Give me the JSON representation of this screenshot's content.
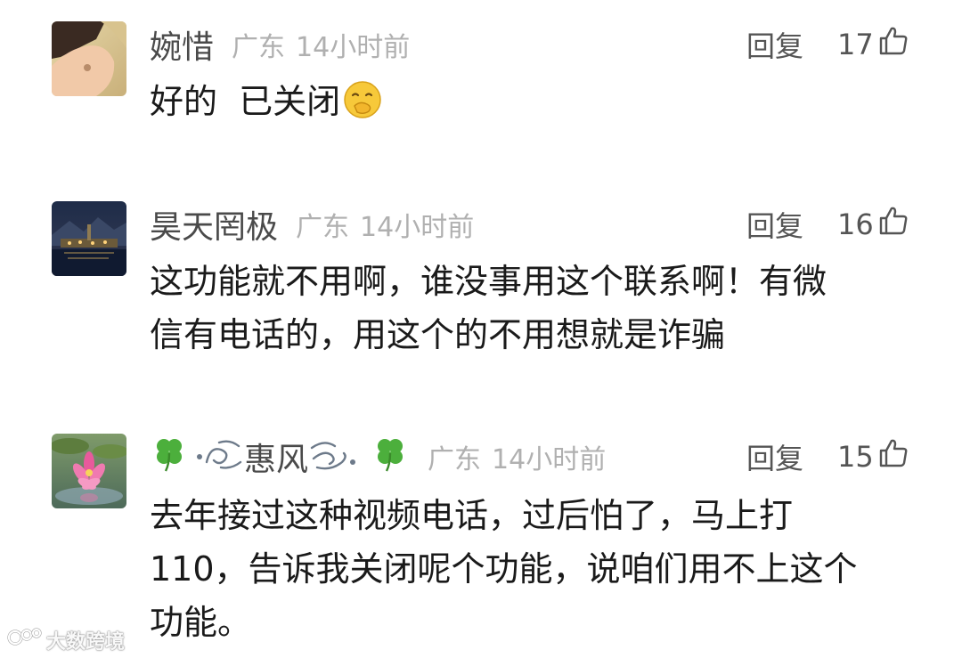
{
  "comments": [
    {
      "username": "婉惜",
      "location": "广东",
      "time": "14小时前",
      "reply_label": "回复",
      "likes": "17",
      "text": "好的  已关闭",
      "emoji": "hand-over-mouth-emoji"
    },
    {
      "username": "昊天罔极",
      "location": "广东",
      "time": "14小时前",
      "reply_label": "回复",
      "likes": "16",
      "text_line1": "这功能就不用啊，谁没事用这个联系啊！有微",
      "text_line2": "信有电话的，用这个的不用想就是诈骗"
    },
    {
      "username": "惠风",
      "location": "广东",
      "time": "14小时前",
      "reply_label": "回复",
      "likes": "15",
      "text_line1": "去年接过这种视频电话，过后怕了，马上打",
      "text_line2": "110，告诉我关闭呢个功能，说咱们用不上这个",
      "text_line3": "功能。"
    }
  ],
  "watermark": {
    "text": "大数跨境"
  },
  "colors": {
    "username": "#4a4a4a",
    "meta": "#b0b0b0",
    "body": "#1a1a1a",
    "clover": "#4caf3c"
  }
}
